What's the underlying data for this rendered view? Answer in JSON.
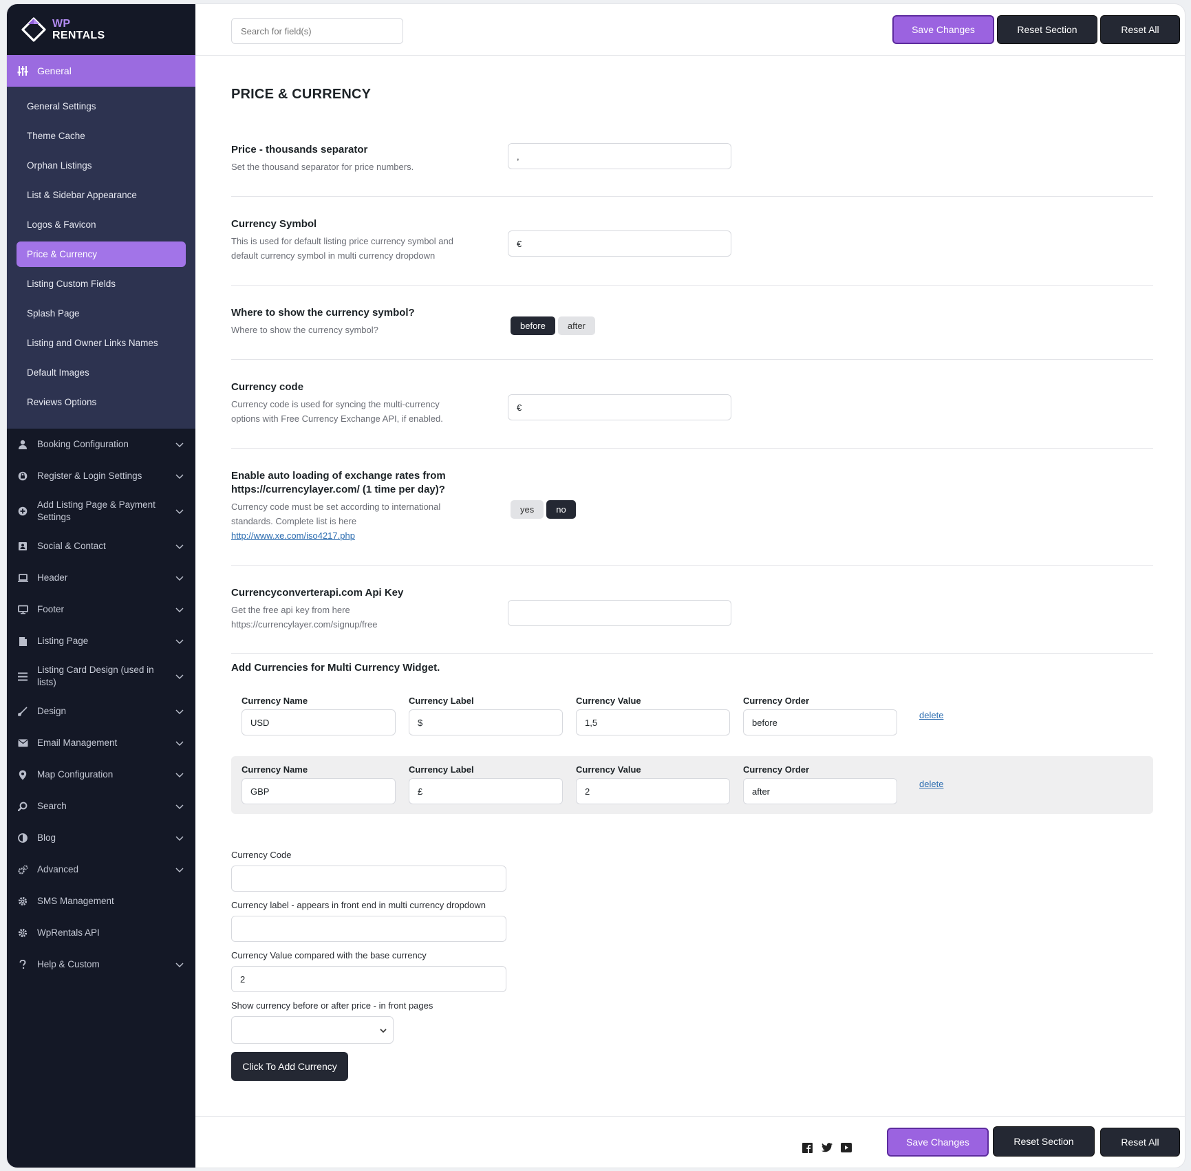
{
  "brand": {
    "top": "WP",
    "bottom": "RENTALS"
  },
  "sidebar": {
    "general_label": "General",
    "submenu": [
      "General Settings",
      "Theme Cache",
      "Orphan Listings",
      "List & Sidebar Appearance",
      "Logos & Favicon",
      "Price & Currency",
      "Listing Custom Fields",
      "Splash Page",
      "Listing and Owner Links Names",
      "Default Images",
      "Reviews Options"
    ],
    "menu": [
      {
        "label": "Booking Configuration",
        "icon": "person-icon",
        "chevron": true
      },
      {
        "label": "Register & Login Settings",
        "icon": "login-icon",
        "chevron": true
      },
      {
        "label": "Add Listing Page & Payment Settings",
        "icon": "plus-circle-icon",
        "chevron": true
      },
      {
        "label": "Social & Contact",
        "icon": "contact-card-icon",
        "chevron": true
      },
      {
        "label": "Header",
        "icon": "laptop-icon",
        "chevron": true
      },
      {
        "label": "Footer",
        "icon": "monitor-icon",
        "chevron": true
      },
      {
        "label": "Listing Page",
        "icon": "document-icon",
        "chevron": true
      },
      {
        "label": "Listing Card Design (used in lists)",
        "icon": "list-icon",
        "chevron": true
      },
      {
        "label": "Design",
        "icon": "brush-icon",
        "chevron": true
      },
      {
        "label": "Email Management",
        "icon": "envelope-icon",
        "chevron": true
      },
      {
        "label": "Map Configuration",
        "icon": "map-pin-icon",
        "chevron": true
      },
      {
        "label": "Search",
        "icon": "search-icon",
        "chevron": true
      },
      {
        "label": "Blog",
        "icon": "half-circle-icon",
        "chevron": true
      },
      {
        "label": "Advanced",
        "icon": "gears-icon",
        "chevron": true
      },
      {
        "label": "SMS Management",
        "icon": "gear-icon",
        "chevron": false
      },
      {
        "label": "WpRentals API",
        "icon": "gear-icon",
        "chevron": false
      },
      {
        "label": "Help & Custom",
        "icon": "question-icon",
        "chevron": true
      }
    ]
  },
  "toolbar": {
    "search_placeholder": "Search for field(s)",
    "save_label": "Save Changes",
    "reset_section_label": "Reset Section",
    "reset_all_label": "Reset All"
  },
  "section": {
    "title": "PRICE & CURRENCY",
    "thousands": {
      "title": "Price - thousands separator",
      "desc": "Set the thousand separator for price numbers.",
      "value": ","
    },
    "symbol": {
      "title": "Currency Symbol",
      "desc": "This is used for default listing price currency symbol and default currency symbol in multi currency dropdown",
      "value": "€"
    },
    "position": {
      "title": "Where to show the currency symbol?",
      "desc": "Where to show the currency symbol?",
      "opt_before": "before",
      "opt_after": "after",
      "selected": "before"
    },
    "code": {
      "title": "Currency code",
      "desc": "Currency code is used for syncing the multi-currency options with Free Currency Exchange API, if enabled.",
      "value": "€"
    },
    "autoload": {
      "title": "Enable auto loading of exchange rates from https://currencylayer.com/ (1 time per day)?",
      "desc": "Currency code must be set according to international standards. Complete list is here",
      "link": "http://www.xe.com/iso4217.php",
      "opt_yes": "yes",
      "opt_no": "no",
      "selected": "no"
    },
    "apikey": {
      "title": "Currencyconverterapi.com Api Key",
      "desc": "Get the free api key from here https://currencylayer.com/signup/free",
      "value": ""
    }
  },
  "multi": {
    "title": "Add Currencies for Multi Currency Widget.",
    "headers": {
      "name": "Currency Name",
      "label": "Currency Label",
      "value": "Currency Value",
      "order": "Currency Order"
    },
    "delete_label": "delete",
    "rows": [
      {
        "name": "USD",
        "label": "$",
        "value": "1,5",
        "order": "before"
      },
      {
        "name": "GBP",
        "label": "£",
        "value": "2",
        "order": "after"
      }
    ]
  },
  "add_form": {
    "code_label": "Currency Code",
    "code_value": "",
    "label_label": "Currency label - appears in front end in multi currency dropdown",
    "label_value": "",
    "value_label": "Currency Value compared with the base currency",
    "value_value": "2",
    "position_label": "Show currency before or after price - in front pages",
    "position_value": "",
    "button_label": "Click To Add Currency"
  },
  "colors": {
    "accent": "#9b63e0",
    "sidebar_bg": "#141826",
    "submenu_bg": "#2d3350",
    "dark_button": "#242833"
  }
}
